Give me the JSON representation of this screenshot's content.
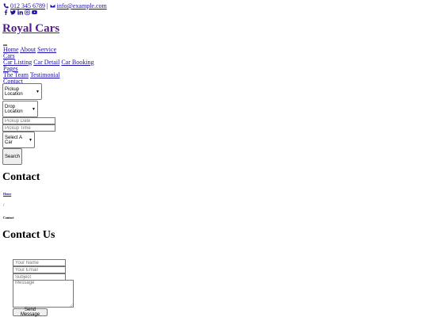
{
  "topbar": {
    "phone": "012 345 6789",
    "separator": "|",
    "email": "info@example.com",
    "social_icons": [
      "facebook-icon",
      "twitter-icon",
      "linkedin-icon",
      "instagram-icon",
      "youtube-icon"
    ]
  },
  "brand": {
    "name": "Royal Cars"
  },
  "nav": {
    "home": "Home",
    "about": "About",
    "service": "Service",
    "cars": "Cars",
    "car_listing": "Car Listing",
    "car_detail": "Car Detail",
    "car_booking": "Car Booking",
    "pages": "Pages",
    "the_team": "The Team",
    "testimonial": "Testimonial",
    "contact": "Contact"
  },
  "search": {
    "pickup_location": "Pickup Location",
    "drop_location": "Drop Location",
    "pickup_date_placeholder": "Pickup Date",
    "pickup_time_placeholder": "Pickup Time",
    "select_car": "Select A Car",
    "button": "Search"
  },
  "page_header": {
    "title": "Contact",
    "breadcrumb_home": "Home",
    "breadcrumb_separator": "/",
    "breadcrumb_current": "Contact"
  },
  "contact": {
    "title": "Contact Us",
    "name_placeholder": "Your Name",
    "email_placeholder": "Your Email",
    "subject_placeholder": "Subject",
    "message_placeholder": "Message",
    "send_button": "Send Message"
  },
  "colors": {
    "link": "#1a0dab",
    "visited_link": "#551a8b"
  }
}
